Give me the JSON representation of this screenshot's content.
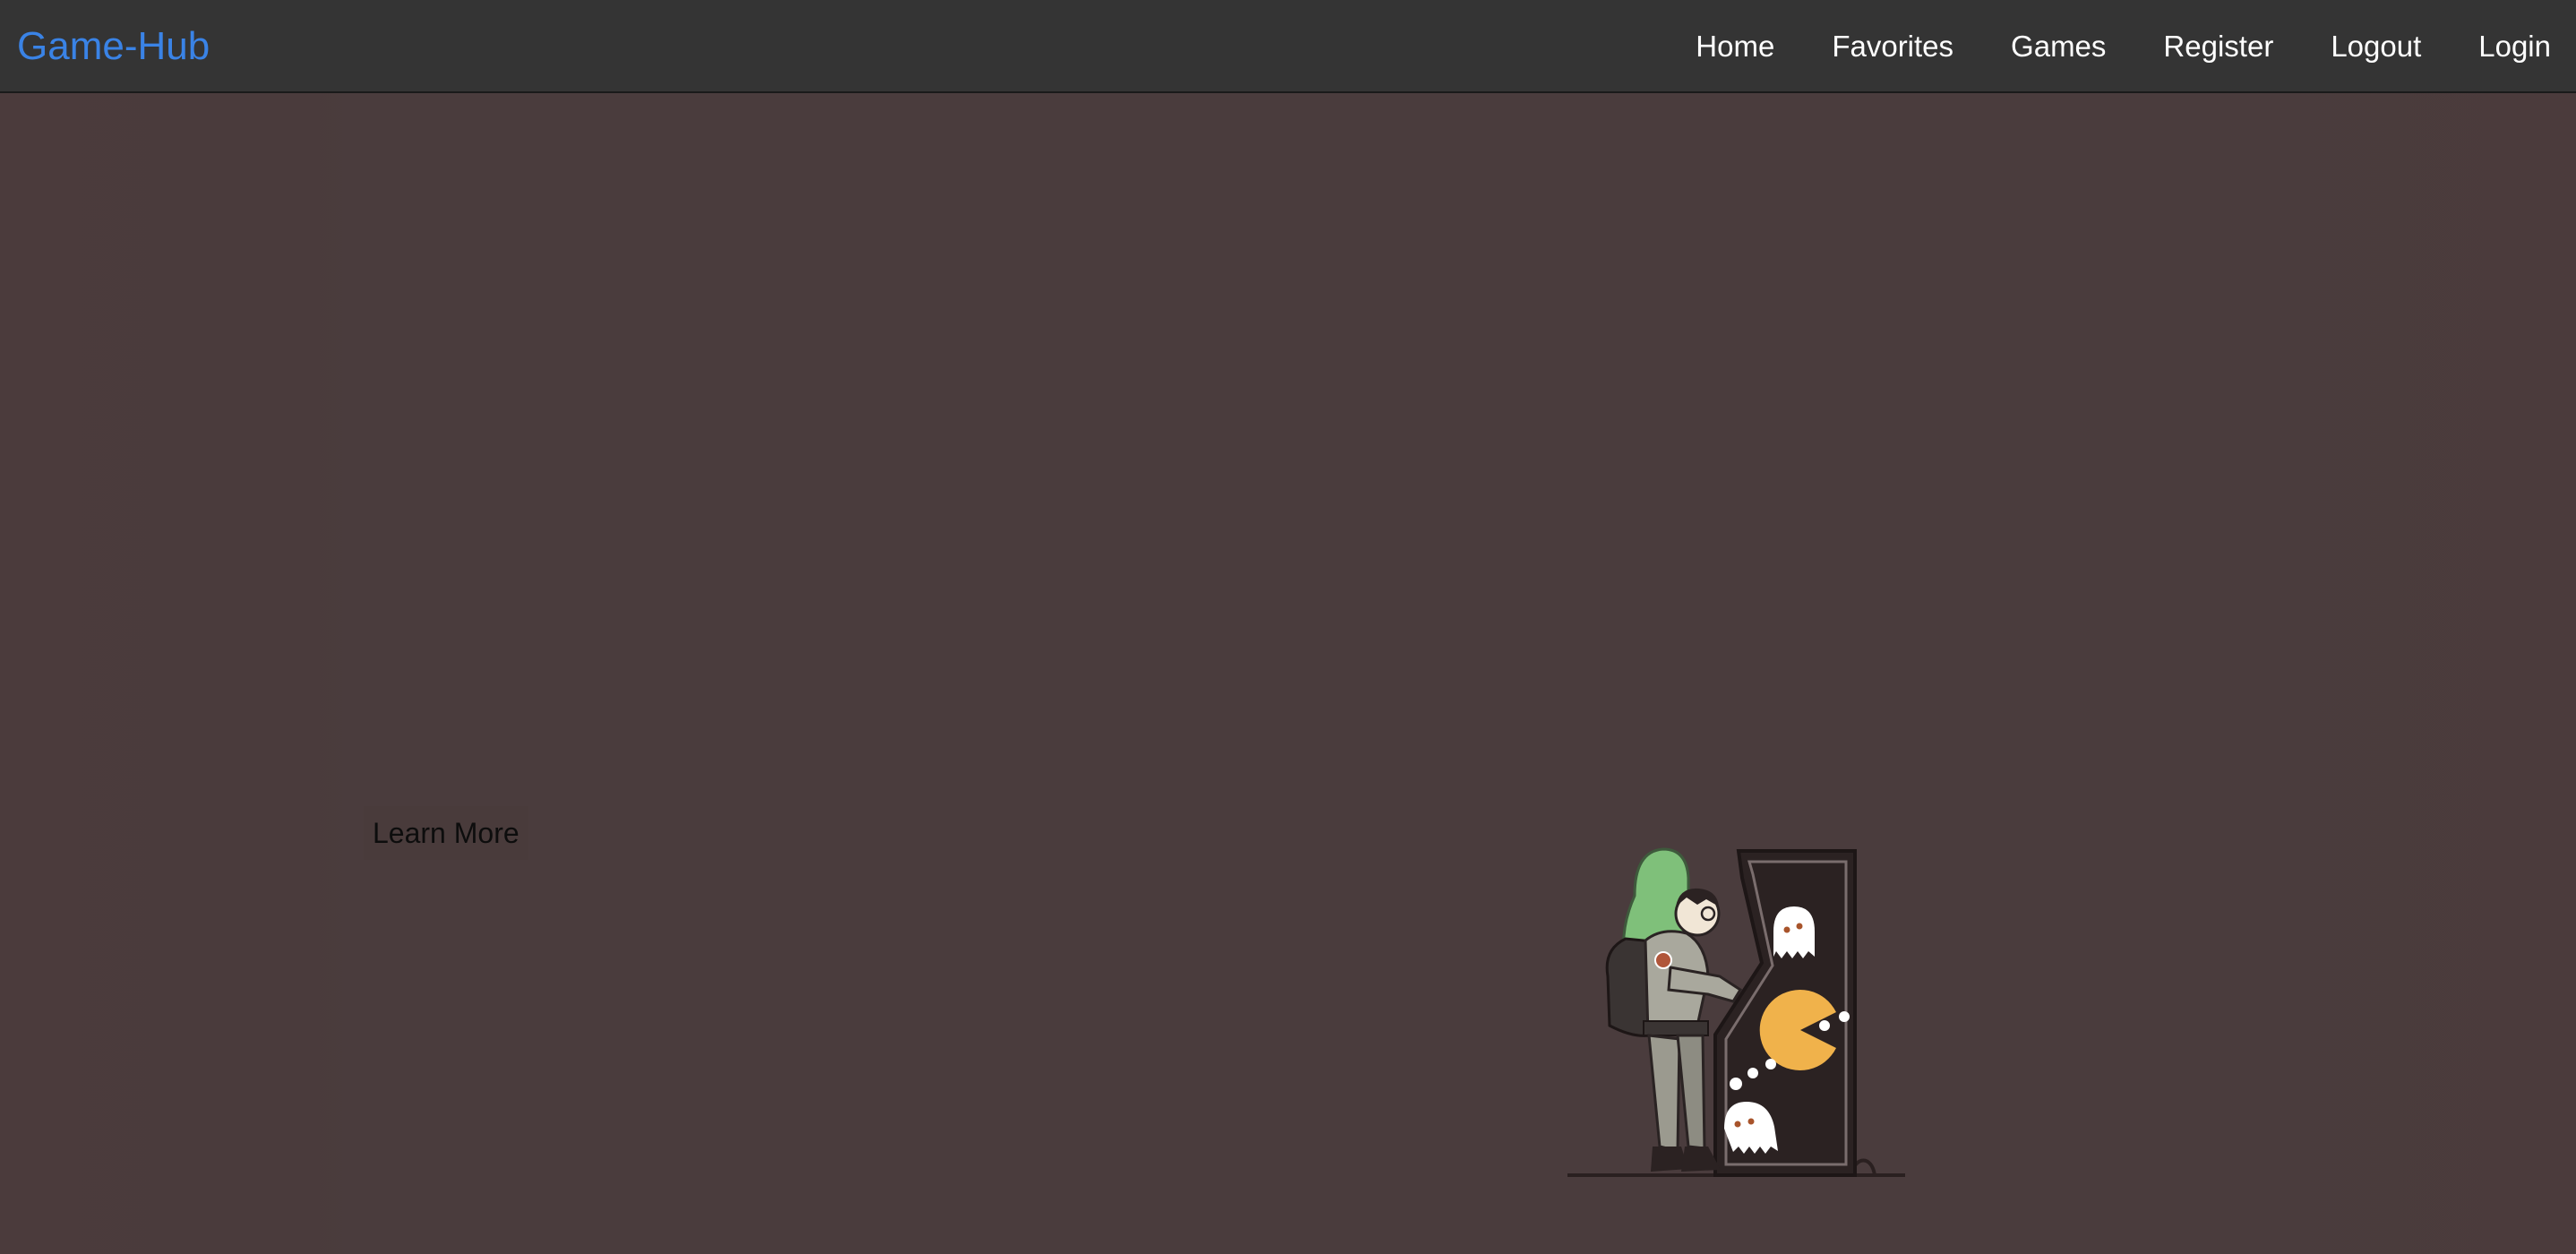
{
  "navbar": {
    "brand": "Game-Hub",
    "links": [
      "Home",
      "Favorites",
      "Games",
      "Register",
      "Logout",
      "Login"
    ]
  },
  "hero": {
    "cta_label": "Learn More",
    "illustration_icon": "arcade-player-illustration"
  },
  "colors": {
    "navbar_bg": "#343434",
    "brand": "#3a83e6",
    "hero_bg": "#4a3c3d",
    "pacman": "#f0b24b",
    "cabinet": "#2b2222"
  }
}
